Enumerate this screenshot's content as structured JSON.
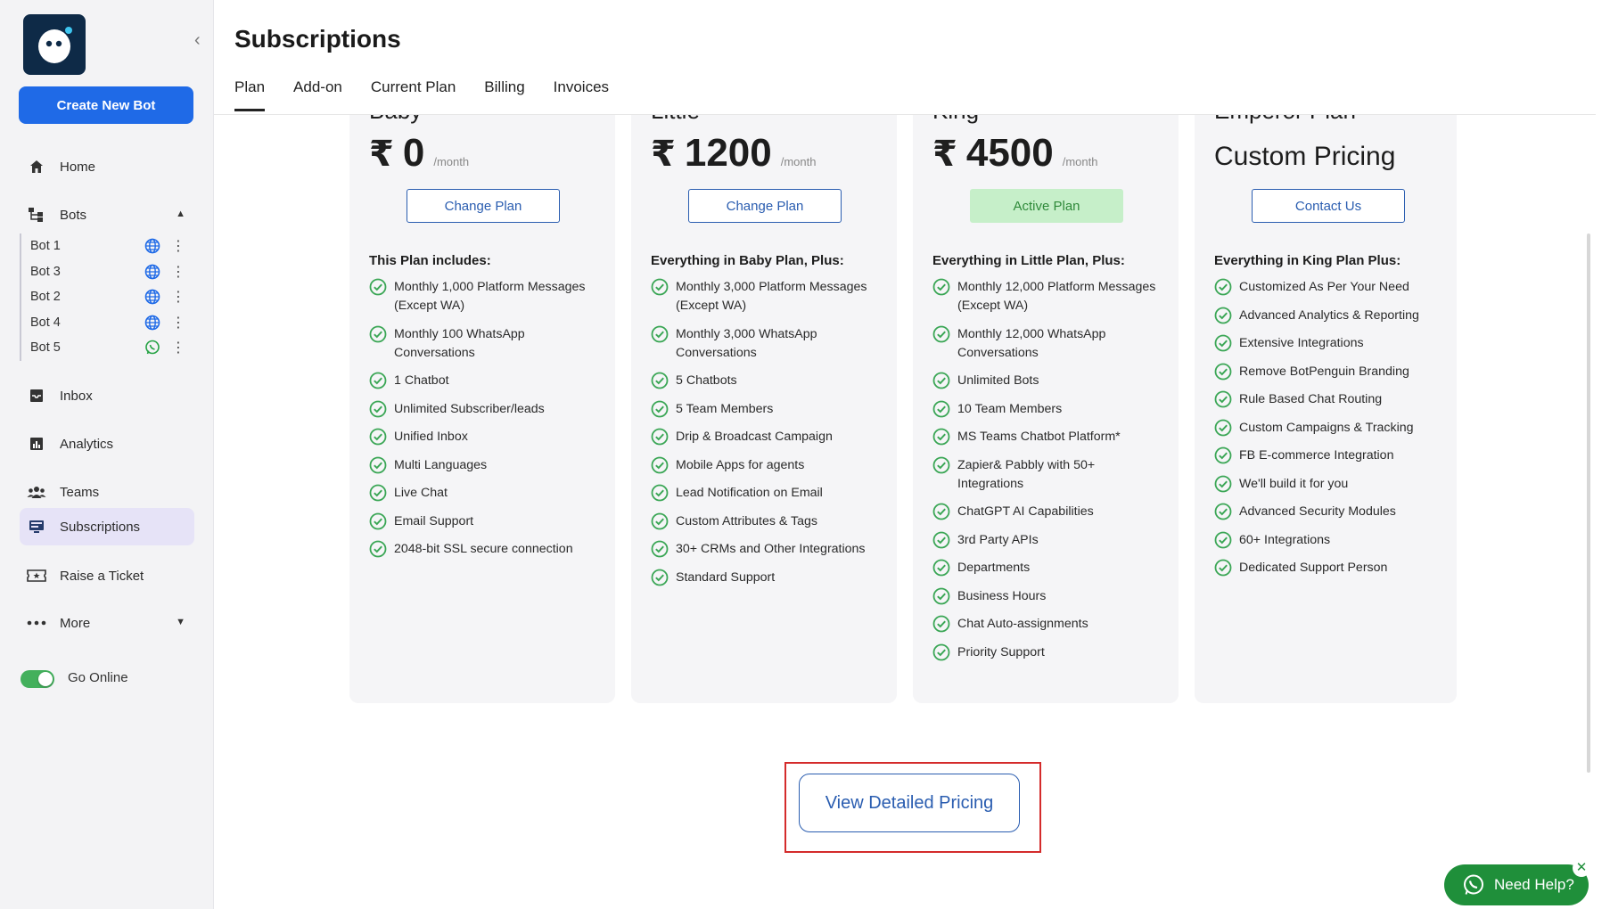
{
  "sidebar": {
    "create_button": "Create New Bot",
    "collapse_icon": "chevron-left-icon",
    "nav": {
      "home": "Home",
      "bots": "Bots",
      "inbox": "Inbox",
      "analytics": "Analytics",
      "teams": "Teams",
      "subscriptions": "Subscriptions",
      "raise_ticket": "Raise a Ticket",
      "more": "More"
    },
    "bots": [
      {
        "name": "Bot 1",
        "channel": "web"
      },
      {
        "name": "Bot 3",
        "channel": "web"
      },
      {
        "name": "Bot 2",
        "channel": "web"
      },
      {
        "name": "Bot 4",
        "channel": "web"
      },
      {
        "name": "Bot 5",
        "channel": "whatsapp"
      }
    ],
    "go_online": {
      "label": "Go Online",
      "enabled": true
    }
  },
  "header": {
    "title": "Subscriptions",
    "tabs": [
      "Plan",
      "Add-on",
      "Current Plan",
      "Billing",
      "Invoices"
    ],
    "active_tab": "Plan"
  },
  "plans": [
    {
      "name_partial": "Baby",
      "currency": "₹",
      "price": "0",
      "period": "/month",
      "button": "Change Plan",
      "button_state": "default",
      "heading": "This Plan includes:",
      "features": [
        "Monthly 1,000 Platform Messages (Except WA)",
        "Monthly 100 WhatsApp Conversations",
        "1 Chatbot",
        "Unlimited Subscriber/leads",
        "Unified Inbox",
        "Multi Languages",
        "Live Chat",
        "Email Support",
        "2048-bit SSL secure connection"
      ]
    },
    {
      "name_partial": "Little",
      "currency": "₹",
      "price": "1200",
      "period": "/month",
      "button": "Change Plan",
      "button_state": "default",
      "heading": "Everything in Baby Plan, Plus:",
      "features": [
        "Monthly 3,000 Platform Messages (Except WA)",
        "Monthly 3,000 WhatsApp Conversations",
        "5 Chatbots",
        "5 Team Members",
        "Drip & Broadcast Campaign",
        "Mobile Apps for agents",
        "Lead Notification on Email",
        "Custom Attributes & Tags",
        "30+ CRMs and Other Integrations",
        "Standard Support"
      ]
    },
    {
      "name_partial": "King",
      "currency": "₹",
      "price": "4500",
      "period": "/month",
      "button": "Active Plan",
      "button_state": "active",
      "heading": "Everything in Little Plan, Plus:",
      "features": [
        "Monthly 12,000 Platform Messages (Except WA)",
        "Monthly 12,000 WhatsApp Conversations",
        "Unlimited Bots",
        "10 Team Members",
        "MS Teams Chatbot Platform*",
        "Zapier& Pabbly with 50+ Integrations",
        "ChatGPT AI Capabilities",
        "3rd Party APIs",
        "Departments",
        "Business Hours",
        "Chat Auto-assignments",
        "Priority Support"
      ]
    },
    {
      "name_partial": "Emperor Plan",
      "custom_price": "Custom Pricing",
      "button": "Contact Us",
      "button_state": "default",
      "heading": "Everything in King Plan Plus:",
      "features": [
        "Customized As Per Your Need",
        "Advanced Analytics & Reporting",
        "Extensive Integrations",
        "Remove BotPenguin Branding",
        "Rule Based Chat Routing",
        "Custom Campaigns & Tracking",
        "FB E-commerce Integration",
        "We'll build it for you",
        "Advanced Security Modules",
        "60+ Integrations",
        "Dedicated Support Person"
      ]
    }
  ],
  "detailed_pricing_button": "View Detailed Pricing",
  "help_widget": {
    "label": "Need Help?",
    "close": "✕"
  },
  "colors": {
    "primary": "#1f6ae7",
    "accent_green": "#43b05c",
    "active_nav": "#e6e3f7",
    "highlight": "#d42b2b"
  }
}
